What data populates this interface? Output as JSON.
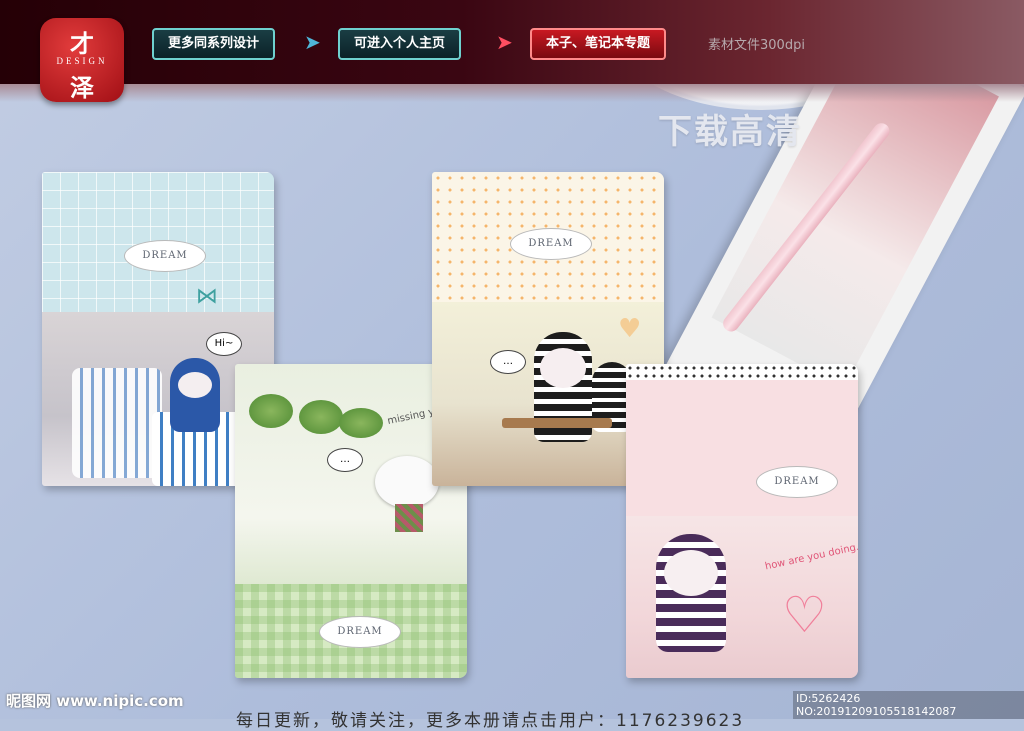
{
  "logo": {
    "top": "才",
    "mid": "DESIGN",
    "bottom": "泽"
  },
  "nav": {
    "tab1": "更多同系列设计",
    "tab2": "可进入个人主页",
    "tab3": "本子、笔记本专题",
    "note": "素材文件300dpi"
  },
  "hd_label": "下载高清",
  "notebooks": {
    "n1": {
      "plaque": "DREAM",
      "bubble": "Hi~"
    },
    "n2": {
      "plaque": "DREAM",
      "tag": "missing you"
    },
    "n3": {
      "plaque": "DREAM"
    },
    "n4": {
      "plaque": "DREAM",
      "tag": "how are you doing......"
    }
  },
  "footer": {
    "watermark": "昵图网 www.nipic.com",
    "id": "ID:5262426 NO:20191209105518142087",
    "caption": "每日更新，敬请关注，更多本册请点击用户：1176239623"
  },
  "colors": {
    "banner": "#2a030b",
    "tab_border": "#6fd1cf",
    "tab_red": "#c81922",
    "background": "#b5c3dd"
  }
}
